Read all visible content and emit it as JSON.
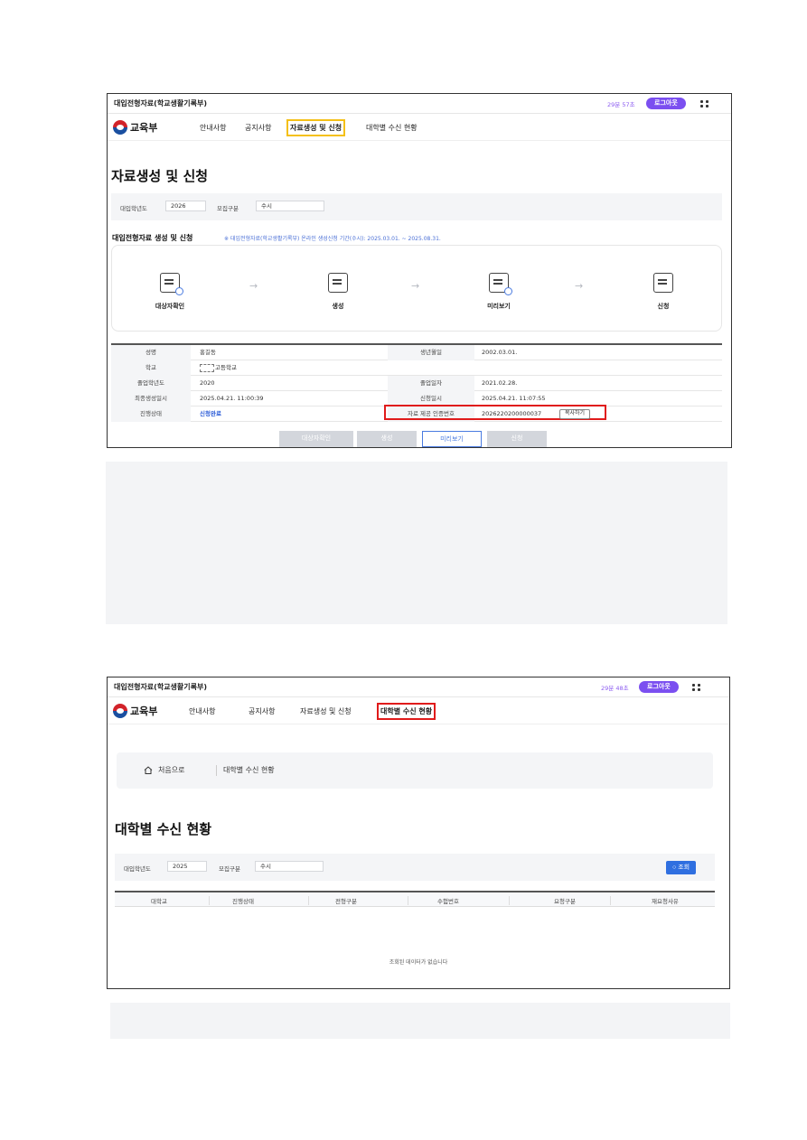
{
  "screen1": {
    "app_title": "대입전형자료(학교생활기록부)",
    "timer": "29분 57초",
    "logout_label": "로그아웃",
    "logo_text": "교육부",
    "nav": [
      "안내사항",
      "공지사항",
      "자료생성 및 신청",
      "대학별 수신 현황"
    ],
    "page_title": "자료생성 및 신청",
    "filters": {
      "year_label": "대입학년도",
      "year_value": "2026",
      "type_label": "모집구분",
      "type_value": "수시"
    },
    "section_label": "대입전형자료 생성 및 신청",
    "notice": "※ 대입전형자료(학교생활기록부) 온라인 생성신청 기간(수시): 2025.03.01. ~ 2025.08.31.",
    "steps": [
      "대상자확인",
      "생성",
      "미리보기",
      "신청"
    ],
    "arrow_glyph": "→",
    "info": {
      "name_label": "성명",
      "name_value": "홍길동",
      "birth_label": "생년월일",
      "birth_value": "2002.03.01.",
      "school_label": "학교",
      "school_value": "고등학교",
      "grad_year_label": "졸업학년도",
      "grad_year_value": "2020",
      "grad_date_label": "졸업일자",
      "grad_date_value": "2021.02.28.",
      "created_label": "최종생성일시",
      "created_value": "2025.04.21. 11:00:39",
      "applied_label": "신청일시",
      "applied_value": "2025.04.21. 11:07:55",
      "status_label": "진행상태",
      "status_value": "신청완료",
      "cert_label": "자료 제공 인증번호",
      "cert_value": "2026220200000037",
      "copy_label": "복사하기"
    },
    "buttons": [
      "대상자확인",
      "생성",
      "미리보기",
      "신청"
    ]
  },
  "screen2": {
    "app_title": "대입전형자료(학교생활기록부)",
    "timer": "29분 48초",
    "logout_label": "로그아웃",
    "logo_text": "교육부",
    "nav": [
      "안내사항",
      "공지사항",
      "자료생성 및 신청",
      "대학별 수신 현황"
    ],
    "breadcrumb_home": "처음으로",
    "breadcrumb_current": "대학별 수신 현황",
    "page_title": "대학별 수신 현황",
    "filters": {
      "year_label": "대입학년도",
      "year_value": "2025",
      "type_label": "모집구분",
      "type_value": "수시"
    },
    "search_label": "조회",
    "columns": [
      "대학교",
      "진행상태",
      "전형구분",
      "수험번호",
      "요청구분",
      "재요청사유"
    ],
    "empty_message": "조회된 데이터가 없습니다"
  },
  "colors": {
    "accent": "#7b4ff0",
    "highlight_yellow": "#f4c017",
    "highlight_red": "#e01b1b",
    "primary_blue": "#2f6fe0"
  }
}
